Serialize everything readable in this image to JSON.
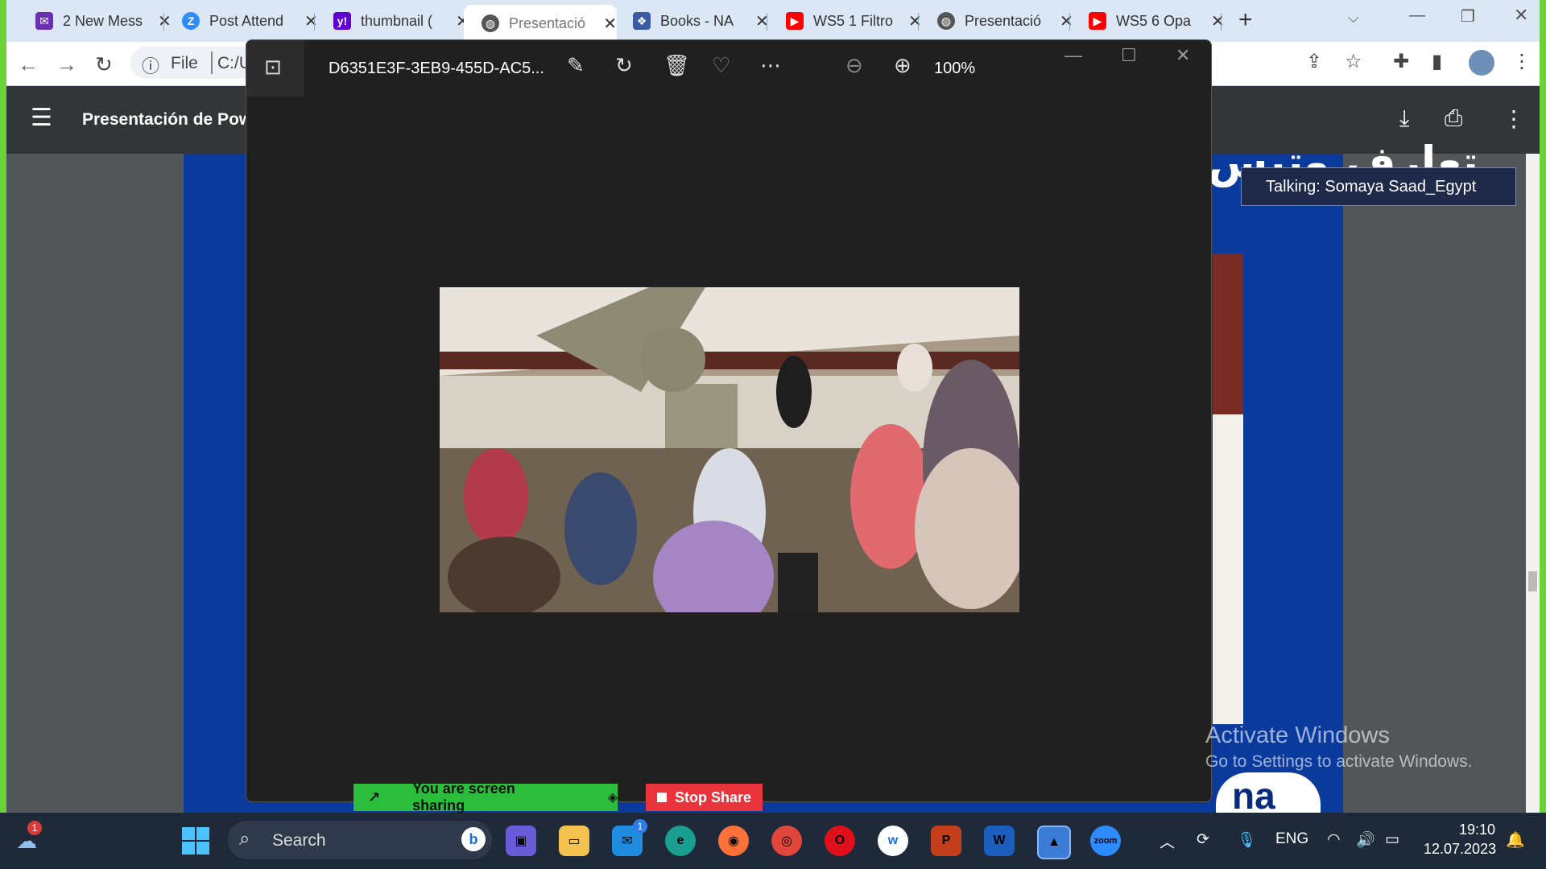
{
  "browser": {
    "tabs": [
      {
        "label": "2 New Mess",
        "favicon": "mail-icon",
        "color": "#6b2fb3"
      },
      {
        "label": "Post Attend",
        "favicon": "zoom-z-icon",
        "color": "#2d8cff"
      },
      {
        "label": "thumbnail (",
        "favicon": "yahoo-icon",
        "color": "#5f01d1"
      },
      {
        "label": "Presentació",
        "favicon": "globe-icon",
        "color": "#555555"
      },
      {
        "label": "Books - NA",
        "favicon": "books-icon",
        "color": "#3b5ba5"
      },
      {
        "label": "WS5 1 Filtro",
        "favicon": "youtube-icon",
        "color": "#ff0000"
      },
      {
        "label": "Presentació",
        "favicon": "globe-icon",
        "color": "#555555"
      },
      {
        "label": "WS5 6 Opa",
        "favicon": "youtube-icon",
        "color": "#ff0000"
      }
    ],
    "address": {
      "scheme": "File",
      "path": "C:/U"
    }
  },
  "pdf": {
    "title": "Presentación de Powe",
    "slide_arabic": "تعارف وتيس",
    "logo_text": "na"
  },
  "photos": {
    "filename": "D6351E3F-3EB9-455D-AC5...",
    "zoom": "100%"
  },
  "share": {
    "status": "You are screen sharing",
    "stop_label": "Stop Share"
  },
  "zoom_talking": "Talking: Somaya Saad_Egypt",
  "watermark": {
    "line1": "Activate Windows",
    "line2": "Go to Settings to activate Windows."
  },
  "taskbar": {
    "search": "Search",
    "language": "ENG",
    "time": "19:10",
    "date": "12.07.2023",
    "weather_badge": "1",
    "mail_badge": "1"
  },
  "colors": {
    "share_border": "#6cd23a",
    "share_green": "#2dbd3c",
    "stop_red": "#e8343a",
    "slide_blue": "#0a3a9c"
  }
}
